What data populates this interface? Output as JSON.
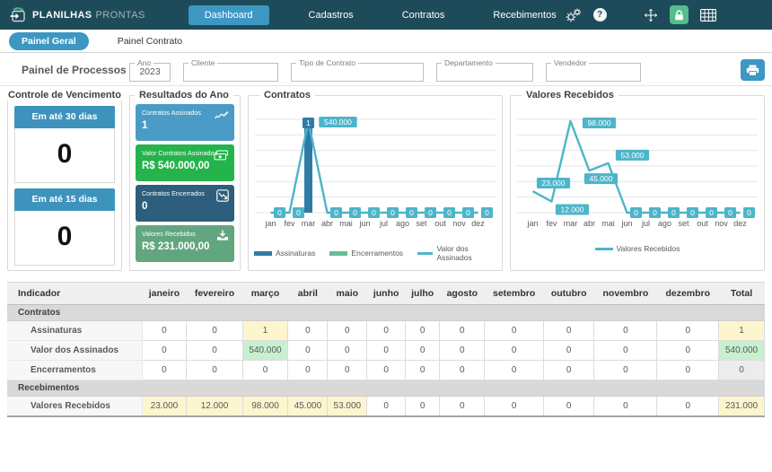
{
  "topnav": {
    "brand": {
      "bold": "PLANILHAS",
      "light": "PRONTAS"
    },
    "items": [
      {
        "label": "Dashboard",
        "active": true
      },
      {
        "label": "Cadastros",
        "active": false
      },
      {
        "label": "Contratos",
        "active": false
      },
      {
        "label": "Recebimentos",
        "active": false
      }
    ]
  },
  "subnav": {
    "tabs": [
      {
        "label": "Painel Geral",
        "active": true
      },
      {
        "label": "Painel Contrato",
        "active": false
      }
    ]
  },
  "filters": {
    "title": "Painel de Processos",
    "fields": [
      {
        "label": "Ano",
        "value": "2023"
      },
      {
        "label": "Cliente",
        "value": ""
      },
      {
        "label": "Tipo de Contrato",
        "value": ""
      },
      {
        "label": "Departamento",
        "value": ""
      },
      {
        "label": "Vendedor",
        "value": ""
      }
    ]
  },
  "vencimento": {
    "title": "Controle de Vencimento",
    "cards": [
      {
        "label": "Em até 30 dias",
        "value": "0"
      },
      {
        "label": "Em até 15 dias",
        "value": "0"
      }
    ]
  },
  "resultados": {
    "title": "Resultados do Ano",
    "cards": [
      {
        "label": "Contratos Assinados",
        "value": "1",
        "color": "#4a9cc6",
        "icon": "signature-icon"
      },
      {
        "label": "Valor Contratos Assinados",
        "value": "R$ 540.000,00",
        "color": "#25b34c",
        "icon": "money-icon"
      },
      {
        "label": "Contratos Encerrados",
        "value": "0",
        "color": "#2d5f7c",
        "icon": "chart-decline-icon"
      },
      {
        "label": "Valores Recebidos",
        "value": "R$ 231.000,00",
        "color": "#62a67f",
        "icon": "inbox-download-icon"
      }
    ]
  },
  "chart_data": [
    {
      "type": "bar",
      "title": "Contratos",
      "categories": [
        "jan",
        "fev",
        "mar",
        "abr",
        "mai",
        "jun",
        "jul",
        "ago",
        "set",
        "out",
        "nov",
        "dez"
      ],
      "series": [
        {
          "name": "Assinaturas",
          "type": "bar",
          "color": "#2e7ca6",
          "values": [
            0,
            0,
            1,
            0,
            0,
            0,
            0,
            0,
            0,
            0,
            0,
            0
          ],
          "labels": [
            "",
            "",
            "1",
            "",
            "",
            "",
            "",
            "",
            "",
            "",
            "",
            ""
          ]
        },
        {
          "name": "Encerramentos",
          "type": "bar",
          "color": "#68bd92",
          "values": [
            0,
            0,
            0,
            0,
            0,
            0,
            0,
            0,
            0,
            0,
            0,
            0
          ],
          "labels": [
            "",
            "",
            "",
            "",
            "",
            "",
            "",
            "",
            "",
            "",
            "",
            ""
          ]
        },
        {
          "name": "Valor dos Assinados",
          "type": "line",
          "color": "#4db5c9",
          "values": [
            0,
            0,
            540000,
            0,
            0,
            0,
            0,
            0,
            0,
            0,
            0,
            0
          ],
          "labels": [
            "0",
            "0",
            "540.000",
            "0",
            "0",
            "0",
            "0",
            "0",
            "0",
            "0",
            "0",
            "0"
          ]
        }
      ],
      "ylim": [
        0,
        540000
      ],
      "grid": true,
      "legend_position": "bottom"
    },
    {
      "type": "line",
      "title": "Valores Recebidos",
      "categories": [
        "jan",
        "fev",
        "mar",
        "abr",
        "mai",
        "jun",
        "jul",
        "ago",
        "set",
        "out",
        "nov",
        "dez"
      ],
      "series": [
        {
          "name": "Valores Recebidos",
          "type": "line",
          "color": "#4db5c9",
          "values": [
            23000,
            12000,
            98000,
            45000,
            53000,
            0,
            0,
            0,
            0,
            0,
            0,
            0
          ],
          "labels": [
            "23.000",
            "12.000",
            "98.000",
            "45.000",
            "53.000",
            "0",
            "0",
            "0",
            "0",
            "0",
            "0",
            "0"
          ]
        }
      ],
      "ylim": [
        0,
        98000
      ],
      "grid": true,
      "legend_position": "bottom"
    }
  ],
  "table": {
    "columns": [
      "Indicador",
      "janeiro",
      "fevereiro",
      "março",
      "abril",
      "maio",
      "junho",
      "julho",
      "agosto",
      "setembro",
      "outubro",
      "novembro",
      "dezembro",
      "Total"
    ],
    "sections": [
      {
        "label": "Contratos",
        "rows": [
          {
            "label": "Assinaturas",
            "values": [
              "0",
              "0",
              "1",
              "0",
              "0",
              "0",
              "0",
              "0",
              "0",
              "0",
              "0",
              "0",
              "1"
            ],
            "highlights": {
              "2": "yellow",
              "12": "yellow"
            }
          },
          {
            "label": "Valor dos Assinados",
            "values": [
              "0",
              "0",
              "540.000",
              "0",
              "0",
              "0",
              "0",
              "0",
              "0",
              "0",
              "0",
              "0",
              "540.000"
            ],
            "highlights": {
              "2": "green",
              "12": "green"
            }
          },
          {
            "label": "Encerramentos",
            "values": [
              "0",
              "0",
              "0",
              "0",
              "0",
              "0",
              "0",
              "0",
              "0",
              "0",
              "0",
              "0",
              "0"
            ],
            "highlights": {
              "12": "gray"
            }
          }
        ]
      },
      {
        "label": "Recebimentos",
        "rows": [
          {
            "label": "Valores Recebidos",
            "values": [
              "23.000",
              "12.000",
              "98.000",
              "45.000",
              "53.000",
              "0",
              "0",
              "0",
              "0",
              "0",
              "0",
              "0",
              "231.000"
            ],
            "highlights": {
              "0": "yellow",
              "1": "yellow",
              "2": "yellow",
              "3": "yellow",
              "4": "yellow",
              "12": "yellow"
            }
          }
        ]
      }
    ]
  }
}
